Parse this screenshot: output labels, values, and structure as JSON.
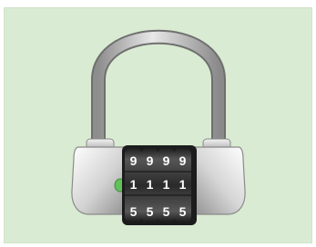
{
  "lock": {
    "name": "combination padlock",
    "dials": [
      {
        "top": "9",
        "middle": "1",
        "bottom": "5"
      },
      {
        "top": "9",
        "middle": "1",
        "bottom": "5"
      },
      {
        "top": "9",
        "middle": "1",
        "bottom": "5"
      },
      {
        "top": "9",
        "middle": "1",
        "bottom": "5"
      }
    ],
    "indicator_color": "#61c15a"
  },
  "colors": {
    "background": "#d9ebd2",
    "body_light": "#f2f2f2",
    "body_dark": "#9a9a9a",
    "shackle": "#9e9e9e",
    "wheel": "#2d2d2d",
    "digit": "#ffffff"
  }
}
